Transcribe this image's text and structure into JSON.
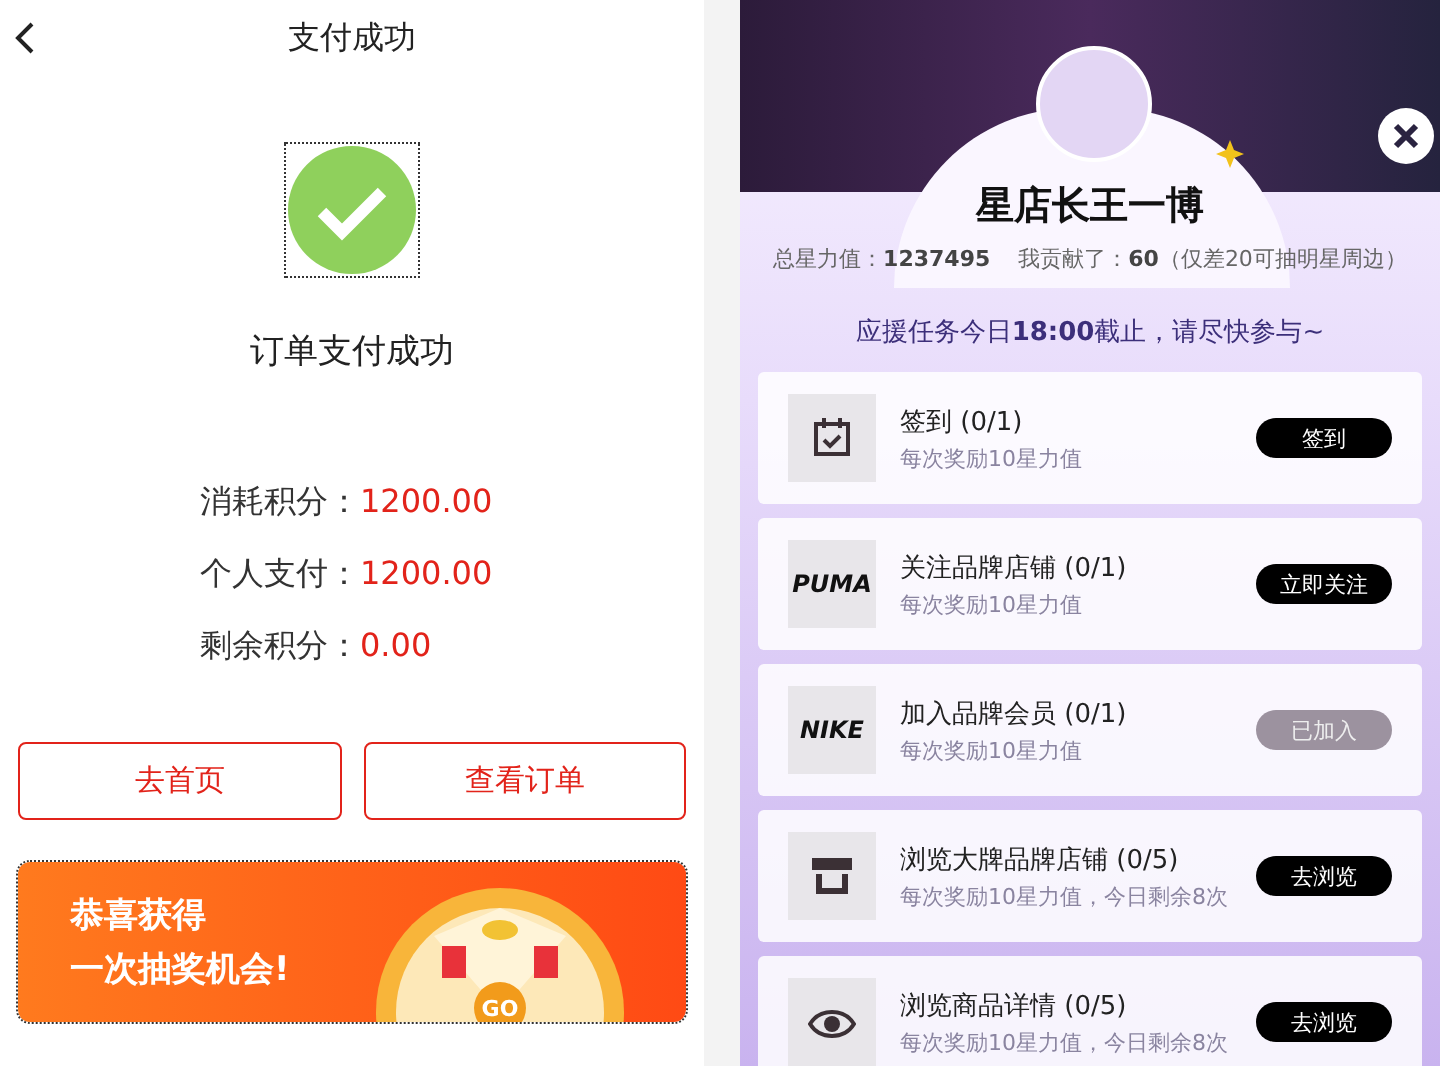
{
  "payment": {
    "title": "支付成功",
    "status": "订单支付成功",
    "details": [
      {
        "label": "消耗积分：",
        "value": "1200.00"
      },
      {
        "label": "个人支付：",
        "value": "1200.00"
      },
      {
        "label": "剩余积分：",
        "value": "0.00"
      }
    ],
    "buttons": [
      "去首页",
      "查看订单"
    ],
    "banner": {
      "lines": [
        "恭喜获得",
        "一次抽奖机会!"
      ],
      "wheel_button": "GO"
    }
  },
  "popup": {
    "name": "星店长王一博",
    "total_label": "总星力值：",
    "total": "1237495",
    "contrib_label": "我贡献了：",
    "contrib": "60",
    "contrib_note": "（仅差20可抽明星周边）",
    "notice": "应援任务今日**18:00**截止，请尽快参与~",
    "tasks": [
      {
        "kind": "calendar",
        "title": "签到 (0/1)",
        "subtitle": "每次奖励10星力值",
        "button": "签到",
        "done": false
      },
      {
        "kind": "puma",
        "logo": "PUMA",
        "title": "关注品牌店铺 (0/1)",
        "subtitle": "每次奖励10星力值",
        "button": "立即关注",
        "done": false
      },
      {
        "kind": "nike",
        "logo": "NIKE",
        "title": "加入品牌会员 (0/1)",
        "subtitle": "每次奖励10星力值",
        "button": "已加入",
        "done": true
      },
      {
        "kind": "store",
        "title": "浏览大牌品牌店铺 (0/5)",
        "subtitle": "每次奖励10星力值，今日剩余8次",
        "button": "去浏览",
        "done": false
      },
      {
        "kind": "eye",
        "title": "浏览商品详情 (0/5)",
        "subtitle": "每次奖励10星力值，今日剩余8次",
        "button": "去浏览",
        "done": false
      }
    ]
  }
}
